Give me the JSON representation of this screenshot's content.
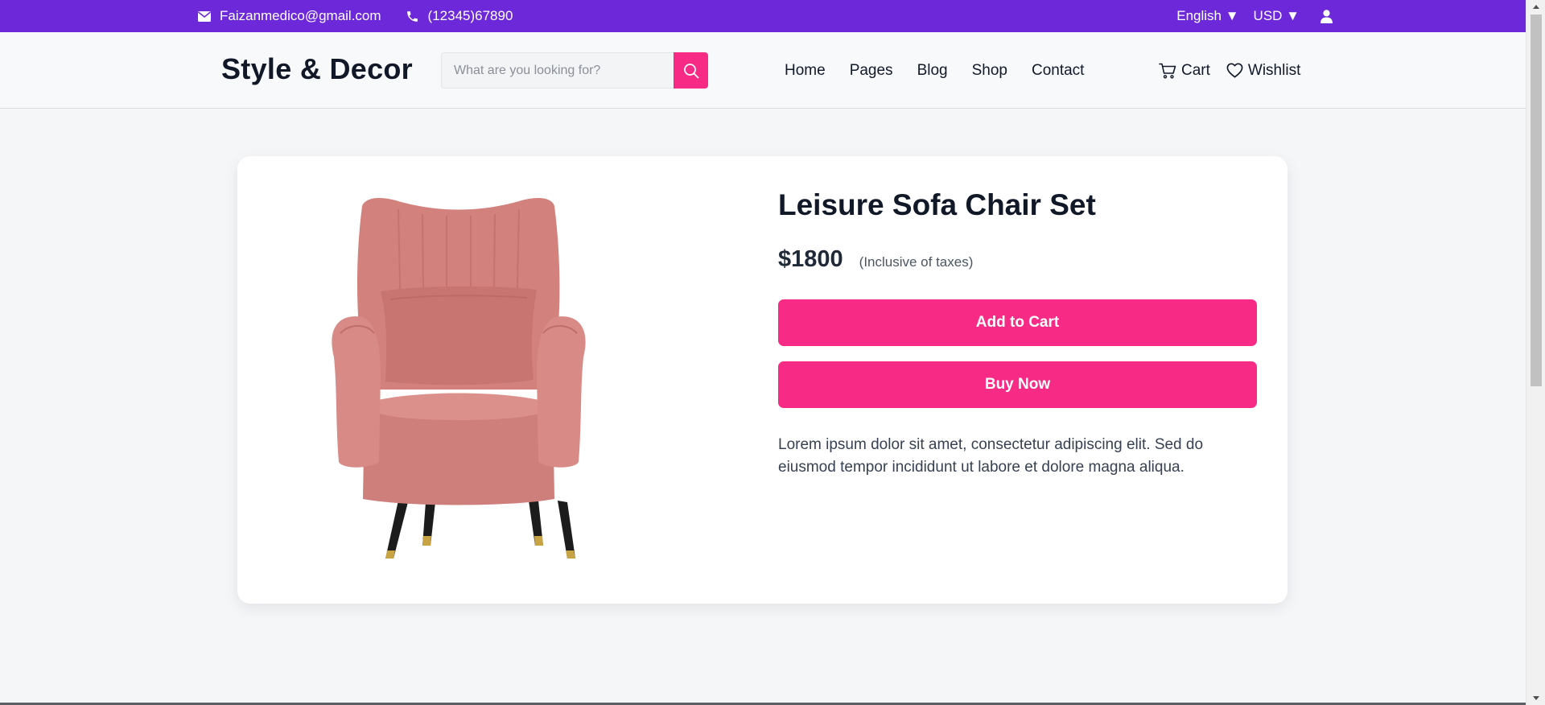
{
  "topbar": {
    "email": "Faizanmedico@gmail.com",
    "phone": "(12345)67890",
    "language": "English ▼",
    "currency": "USD ▼"
  },
  "header": {
    "logo": "Style & Decor",
    "search_placeholder": "What are you looking for?",
    "nav": [
      "Home",
      "Pages",
      "Blog",
      "Shop",
      "Contact"
    ],
    "cart_label": "Cart",
    "wishlist_label": "Wishlist"
  },
  "product": {
    "title": "Leisure Sofa Chair Set",
    "price": "$1800",
    "tax_note": "(Inclusive of taxes)",
    "add_to_cart": "Add to Cart",
    "buy_now": "Buy Now",
    "description": "Lorem ipsum dolor sit amet, consectetur adipiscing elit. Sed do eiusmod tempor incididunt ut labore et dolore magna aliqua."
  },
  "colors": {
    "topbar_bg": "#6d28d9",
    "accent_pink": "#f72a85",
    "chair_pink": "#d98a86"
  },
  "icons": [
    "envelope-icon",
    "phone-icon",
    "user-icon",
    "search-icon",
    "cart-icon",
    "heart-icon"
  ]
}
